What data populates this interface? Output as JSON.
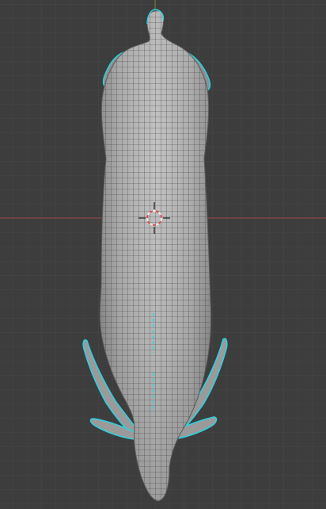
{
  "viewport": {
    "view": "top-orthographic",
    "background_color": "#3d3d3d",
    "grid_color": "#4a4a4a",
    "x_axis_color": "#9a4a4a",
    "y_axis_color": "#6f8a3a"
  },
  "model": {
    "mesh_color": "#a8a8a8",
    "wire_color": "#2f2f2f",
    "selection_color": "#2fd0e0",
    "mode": "sculpt"
  },
  "cursor": {
    "icon": "3d-cursor-icon",
    "ring_colors": [
      "#e04a4a",
      "#f0f0f0"
    ]
  }
}
